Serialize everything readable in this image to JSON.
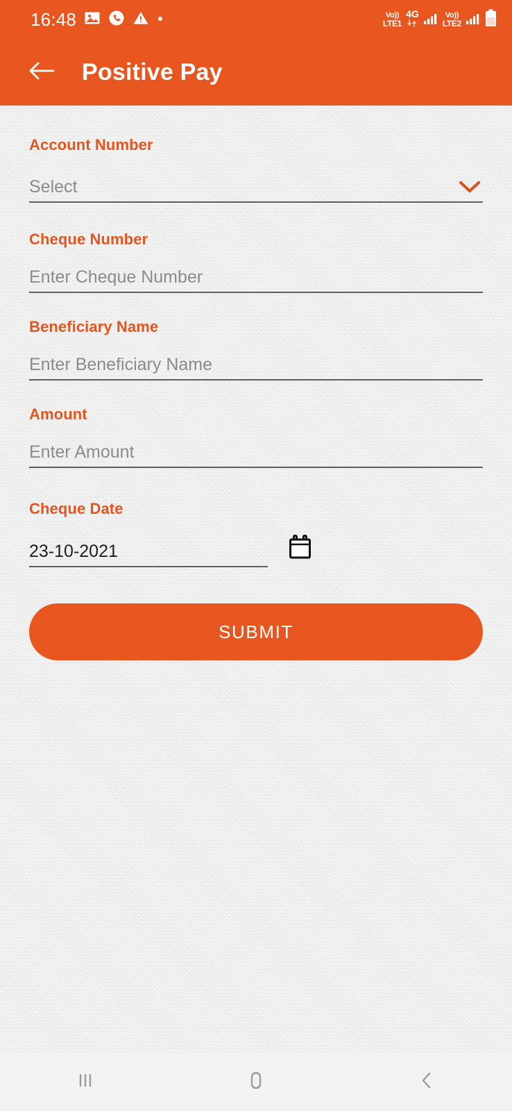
{
  "status_bar": {
    "time": "16:48",
    "left_icons": [
      "photo-icon",
      "phone-call-icon",
      "warning-triangle-icon",
      "dot-icon"
    ],
    "sim1": {
      "volte_top": "Vo))",
      "volte_bottom": "LTE1"
    },
    "network": {
      "label": "4G",
      "data_arrows": "data-transfer-icon"
    },
    "sim2": {
      "volte_top": "Vo))",
      "volte_bottom": "LTE2"
    },
    "battery": "battery-icon",
    "background_color": "#e8561f"
  },
  "app_bar": {
    "back_icon": "back-arrow-icon",
    "title": "Positive Pay",
    "background_color": "#e8561f",
    "title_color": "#ffffff"
  },
  "form": {
    "label_color": "#e2551f",
    "fields": [
      {
        "label": "Account Number",
        "value": "",
        "placeholder": "Select",
        "type": "dropdown",
        "icon": "chevron-down-icon"
      },
      {
        "label": "Cheque Number",
        "value": "",
        "placeholder": "Enter Cheque Number",
        "type": "text"
      },
      {
        "label": "Beneficiary Name",
        "value": "",
        "placeholder": "Enter Beneficiary Name",
        "type": "text"
      },
      {
        "label": "Amount",
        "value": "",
        "placeholder": "Enter Amount",
        "type": "text"
      },
      {
        "label": "Cheque Date",
        "value": "23-10-2021",
        "placeholder": "",
        "type": "date",
        "icon": "calendar-icon"
      }
    ],
    "submit_label": "SUBMIT",
    "submit_color": "#e8561f"
  },
  "nav_bar": {
    "recents": "recents-icon",
    "home": "home-icon",
    "back": "back-chevron-icon",
    "background_color": "#f2f2f1"
  }
}
